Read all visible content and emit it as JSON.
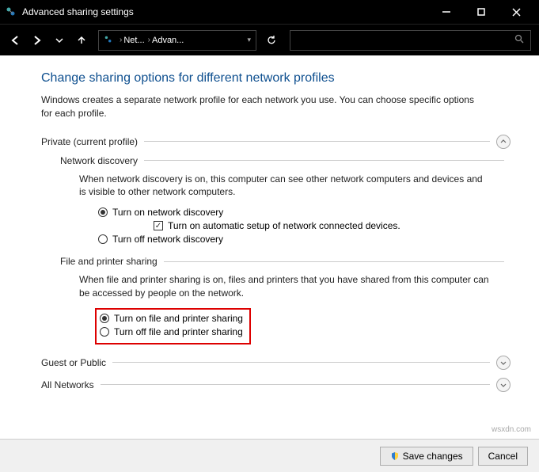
{
  "window": {
    "title": "Advanced sharing settings"
  },
  "breadcrumb": {
    "segment1": "Net...",
    "segment2": "Advan..."
  },
  "page": {
    "title": "Change sharing options for different network profiles",
    "description": "Windows creates a separate network profile for each network you use. You can choose specific options for each profile."
  },
  "private_section": {
    "label": "Private (current profile)",
    "network_discovery": {
      "label": "Network discovery",
      "description": "When network discovery is on, this computer can see other network computers and devices and is visible to other network computers.",
      "option_on": "Turn on network discovery",
      "checkbox_auto": "Turn on automatic setup of network connected devices.",
      "option_off": "Turn off network discovery"
    },
    "file_printer": {
      "label": "File and printer sharing",
      "description": "When file and printer sharing is on, files and printers that you have shared from this computer can be accessed by people on the network.",
      "option_on": "Turn on file and printer sharing",
      "option_off": "Turn off file and printer sharing"
    }
  },
  "guest_section": {
    "label": "Guest or Public"
  },
  "all_networks_section": {
    "label": "All Networks"
  },
  "footer": {
    "save": "Save changes",
    "cancel": "Cancel"
  },
  "watermark": "wsxdn.com"
}
